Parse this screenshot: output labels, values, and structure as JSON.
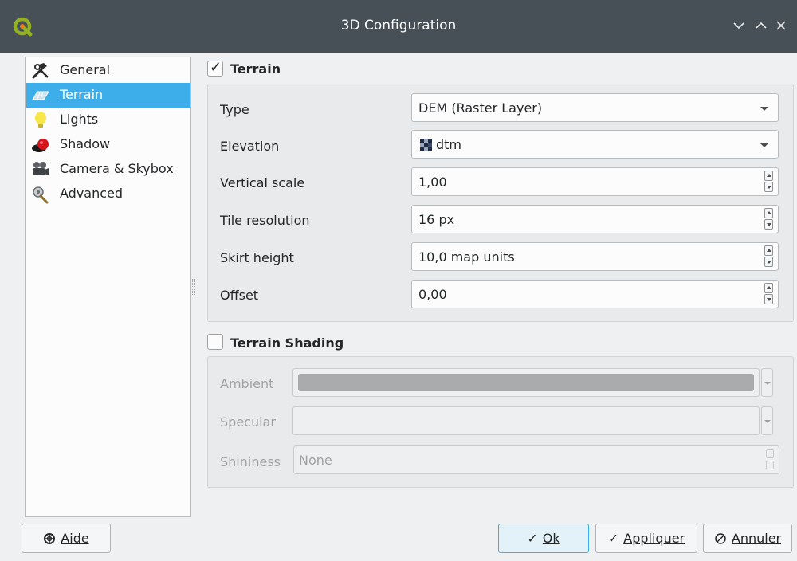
{
  "window": {
    "title": "3D Configuration"
  },
  "sidebar": {
    "items": [
      {
        "label": "General",
        "icon": "hammer-wrench-icon"
      },
      {
        "label": "Terrain",
        "icon": "terrain-icon",
        "selected": true
      },
      {
        "label": "Lights",
        "icon": "lightbulb-icon"
      },
      {
        "label": "Shadow",
        "icon": "shadow-icon"
      },
      {
        "label": "Camera & Skybox",
        "icon": "camera-icon"
      },
      {
        "label": "Advanced",
        "icon": "advanced-settings-icon"
      }
    ]
  },
  "terrain": {
    "title": "Terrain",
    "checked": true,
    "fields": {
      "type": {
        "label": "Type",
        "value": "DEM (Raster Layer)"
      },
      "elevation": {
        "label": "Elevation",
        "value": "dtm"
      },
      "vertical_scale": {
        "label": "Vertical scale",
        "value": "1,00"
      },
      "tile_resolution": {
        "label": "Tile resolution",
        "value": "16 px"
      },
      "skirt_height": {
        "label": "Skirt height",
        "value": "10,0 map units"
      },
      "offset": {
        "label": "Offset",
        "value": "0,00"
      }
    }
  },
  "shading": {
    "title": "Terrain Shading",
    "checked": false,
    "ambient_label": "Ambient",
    "specular_label": "Specular",
    "shininess_label": "Shininess",
    "shininess_value": "None"
  },
  "buttons": {
    "help": "Aide",
    "ok": "Ok",
    "apply": "Appliquer",
    "cancel": "Annuler"
  },
  "colors": {
    "selection": "#3daee9",
    "titlebar": "#475057",
    "window_bg": "#eff0f1"
  }
}
